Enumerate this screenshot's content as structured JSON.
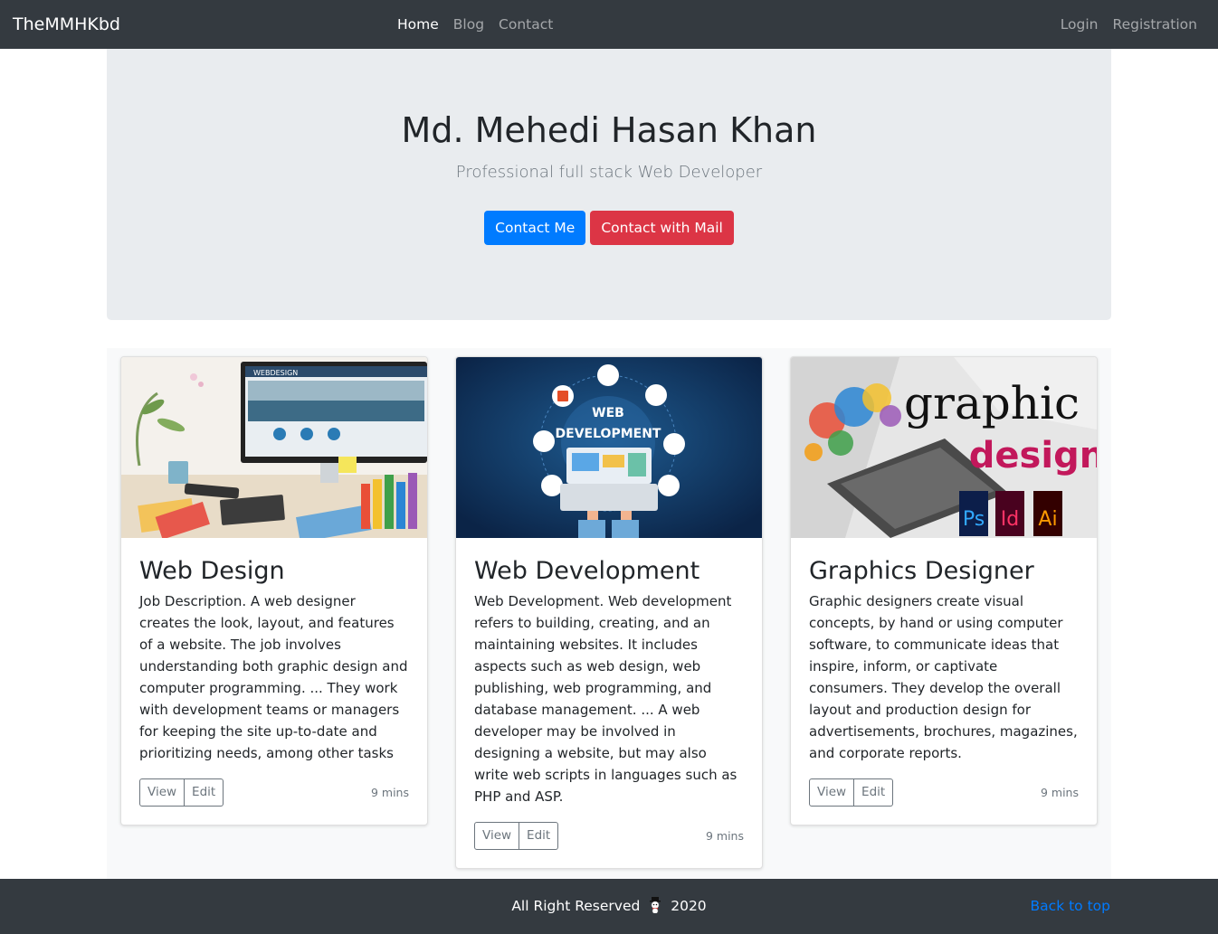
{
  "nav": {
    "brand": "TheMMHKbd",
    "links": [
      "Home",
      "Blog",
      "Contact"
    ],
    "auth": [
      "Login",
      "Registration"
    ]
  },
  "hero": {
    "title": "Md. Mehedi Hasan Khan",
    "subtitle": "Professional full stack Web Developer",
    "primary_button": "Contact Me",
    "secondary_button": "Contact with Mail"
  },
  "cards": [
    {
      "title": "Web Design",
      "text": "Job Description. A web designer creates the look, layout, and features of a website. The job involves understanding both graphic design and computer programming. ... They work with development teams or managers for keeping the site up-to-date and prioritizing needs, among other tasks",
      "view": "View",
      "edit": "Edit",
      "time": "9 mins",
      "image_text": "WEBDESIGN"
    },
    {
      "title": "Web Development",
      "text": "Web Development. Web development refers to building, creating, and an maintaining websites. It includes aspects such as web design, web publishing, web programming, and database management. ... A web developer may be involved in designing a website, but may also write web scripts in languages such as PHP and ASP.",
      "view": "View",
      "edit": "Edit",
      "time": "9 mins",
      "image_text": [
        "WEB",
        "DEVELOPMENT"
      ]
    },
    {
      "title": "Graphics Designer",
      "text": "Graphic designers create visual concepts, by hand or using computer software, to communicate ideas that inspire, inform, or captivate consumers. They develop the overall layout and production design for advertisements, brochures, magazines, and corporate reports.",
      "view": "View",
      "edit": "Edit",
      "time": "9 mins",
      "image_text": [
        "graphic",
        "design",
        "Ps",
        "Id",
        "Ai"
      ]
    }
  ],
  "footer": {
    "text_before": "All Right Reserved",
    "text_after": "2020",
    "back_to_top": "Back to top"
  },
  "colors": {
    "navbar": "#343a40",
    "primary": "#007bff",
    "danger": "#dc3545",
    "jumbotron": "#e9ecef"
  }
}
